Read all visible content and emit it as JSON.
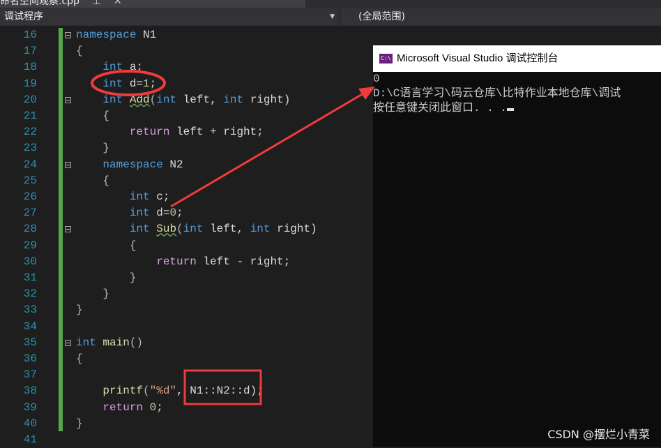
{
  "tab": {
    "title": "命名空间观察.cpp",
    "pin": "⊥",
    "close": "✕"
  },
  "toolbar": {
    "project_combo": "调试程序",
    "scope_combo": "(全局范围)"
  },
  "editor": {
    "lines": [
      {
        "num": "16",
        "fold": true,
        "tokens": [
          [
            "namespace",
            "kw"
          ],
          [
            " N1",
            "id"
          ]
        ]
      },
      {
        "num": "17",
        "tokens": [
          [
            "{",
            "pn"
          ]
        ]
      },
      {
        "num": "18",
        "tokens": [
          [
            "    "
          ],
          [
            "int",
            "kw"
          ],
          [
            " a;",
            "id"
          ]
        ]
      },
      {
        "num": "19",
        "tokens": [
          [
            "    "
          ],
          [
            "int",
            "kw"
          ],
          [
            " d=",
            "id"
          ],
          [
            "1",
            "num"
          ],
          [
            ";",
            "id"
          ]
        ]
      },
      {
        "num": "20",
        "fold": true,
        "tokens": [
          [
            "    "
          ],
          [
            "int",
            "kw"
          ],
          [
            " "
          ],
          [
            "Add",
            "fn squig"
          ],
          [
            "(",
            "pn"
          ],
          [
            "int",
            "kw"
          ],
          [
            " left, ",
            "id"
          ],
          [
            "int",
            "kw"
          ],
          [
            " right)",
            "id"
          ]
        ]
      },
      {
        "num": "21",
        "tokens": [
          [
            "    {",
            "pn"
          ]
        ]
      },
      {
        "num": "22",
        "tokens": [
          [
            "        "
          ],
          [
            "return",
            "ctl"
          ],
          [
            " left + right;",
            "id"
          ]
        ]
      },
      {
        "num": "23",
        "tokens": [
          [
            "    }",
            "pn"
          ]
        ]
      },
      {
        "num": "24",
        "fold": true,
        "tokens": [
          [
            "    "
          ],
          [
            "namespace",
            "kw"
          ],
          [
            " N2",
            "id"
          ]
        ]
      },
      {
        "num": "25",
        "tokens": [
          [
            "    {",
            "pn"
          ]
        ]
      },
      {
        "num": "26",
        "tokens": [
          [
            "        "
          ],
          [
            "int",
            "kw"
          ],
          [
            " c;",
            "id"
          ]
        ]
      },
      {
        "num": "27",
        "tokens": [
          [
            "        "
          ],
          [
            "int",
            "kw"
          ],
          [
            " d=",
            "id"
          ],
          [
            "0",
            "num"
          ],
          [
            ";",
            "id"
          ]
        ]
      },
      {
        "num": "28",
        "fold": true,
        "tokens": [
          [
            "        "
          ],
          [
            "int",
            "kw"
          ],
          [
            " "
          ],
          [
            "Sub",
            "fn squig"
          ],
          [
            "(",
            "pn"
          ],
          [
            "int",
            "kw"
          ],
          [
            " left, ",
            "id"
          ],
          [
            "int",
            "kw"
          ],
          [
            " right)",
            "id"
          ]
        ]
      },
      {
        "num": "29",
        "tokens": [
          [
            "        {",
            "pn"
          ]
        ]
      },
      {
        "num": "30",
        "tokens": [
          [
            "            "
          ],
          [
            "return",
            "ctl"
          ],
          [
            " left - right;",
            "id"
          ]
        ]
      },
      {
        "num": "31",
        "tokens": [
          [
            "        }",
            "pn"
          ]
        ]
      },
      {
        "num": "32",
        "tokens": [
          [
            "    }",
            "pn"
          ]
        ]
      },
      {
        "num": "33",
        "tokens": [
          [
            "}",
            "pn"
          ]
        ]
      },
      {
        "num": "34",
        "tokens": []
      },
      {
        "num": "35",
        "fold": true,
        "tokens": [
          [
            "int",
            "kw"
          ],
          [
            " "
          ],
          [
            "main",
            "fn"
          ],
          [
            "()",
            "pn"
          ]
        ]
      },
      {
        "num": "36",
        "tokens": [
          [
            "{",
            "pn"
          ]
        ]
      },
      {
        "num": "37",
        "tokens": []
      },
      {
        "num": "38",
        "tokens": [
          [
            "    "
          ],
          [
            "printf",
            "fn"
          ],
          [
            "(",
            "pn"
          ],
          [
            "\"%d\"",
            "str"
          ],
          [
            ", N1::N2::d);",
            "id"
          ]
        ]
      },
      {
        "num": "39",
        "tokens": [
          [
            "    "
          ],
          [
            "return",
            "ctl"
          ],
          [
            " "
          ],
          [
            "0",
            "num"
          ],
          [
            ";",
            "id"
          ]
        ]
      },
      {
        "num": "40",
        "tokens": [
          [
            "}",
            "pn"
          ]
        ]
      },
      {
        "num": "41",
        "tokens": []
      }
    ]
  },
  "console": {
    "icon": "C:\\",
    "title": "Microsoft Visual Studio 调试控制台",
    "output": [
      "0",
      "D:\\C语言学习\\码云仓库\\比特作业本地仓库\\调试",
      "按任意键关闭此窗口. . ."
    ]
  },
  "watermark": "CSDN @摆烂小青菜",
  "colors": {
    "annotation": "#ef3b3b",
    "line_number": "#2b91af",
    "keyword": "#569cd6"
  }
}
